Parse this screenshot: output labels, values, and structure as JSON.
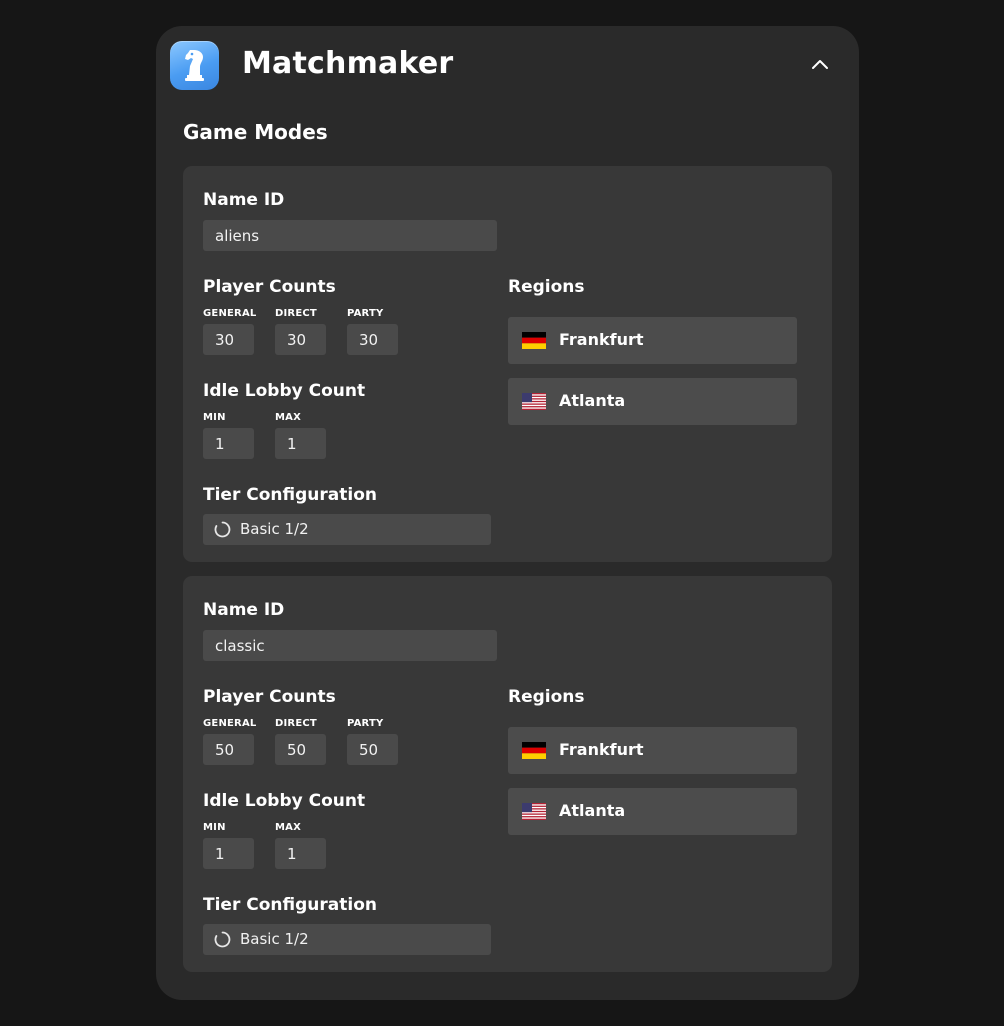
{
  "app": {
    "title": "Matchmaker",
    "icon": "chess-knight-icon"
  },
  "section": {
    "title": "Game Modes"
  },
  "labels": {
    "name_id": "Name ID",
    "player_counts": "Player Counts",
    "general": "GENERAL",
    "direct": "DIRECT",
    "party": "PARTY",
    "idle_lobby_count": "Idle Lobby Count",
    "min": "MIN",
    "max": "MAX",
    "tier_configuration": "Tier Configuration",
    "regions": "Regions"
  },
  "modes": [
    {
      "name_id": "aliens",
      "player_counts": {
        "general": "30",
        "direct": "30",
        "party": "30"
      },
      "idle_lobby": {
        "min": "1",
        "max": "1"
      },
      "tier": "Basic 1/2",
      "regions": [
        {
          "name": "Frankfurt",
          "flag": "germany-flag-icon"
        },
        {
          "name": "Atlanta",
          "flag": "usa-flag-icon"
        }
      ]
    },
    {
      "name_id": "classic",
      "player_counts": {
        "general": "50",
        "direct": "50",
        "party": "50"
      },
      "idle_lobby": {
        "min": "1",
        "max": "1"
      },
      "tier": "Basic 1/2",
      "regions": [
        {
          "name": "Frankfurt",
          "flag": "germany-flag-icon"
        },
        {
          "name": "Atlanta",
          "flag": "usa-flag-icon"
        }
      ]
    }
  ],
  "colors": {
    "background": "#161616",
    "panel": "#2a2a2a",
    "card": "#383838",
    "input": "#4a4a4a",
    "region": "#4c4c4c",
    "accent": "#4a9cf2"
  }
}
